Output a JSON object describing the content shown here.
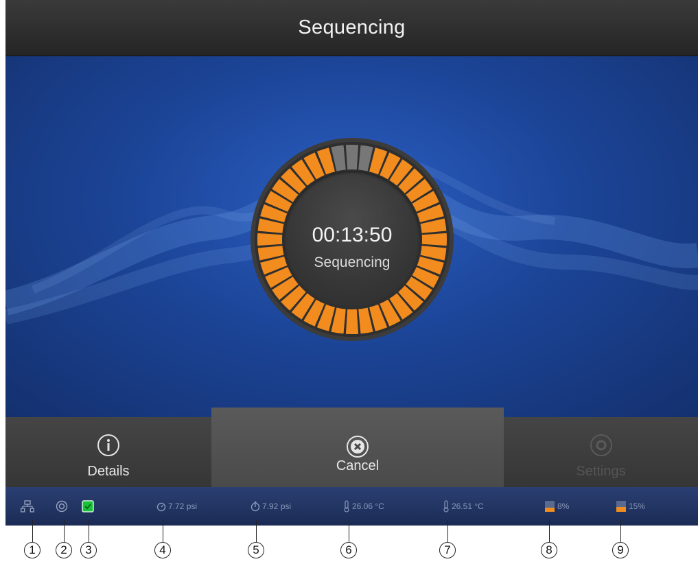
{
  "title": "Sequencing",
  "timer": {
    "time": "00:13:50",
    "status": "Sequencing",
    "segments_total": 40,
    "segments_remaining": 3
  },
  "buttons": {
    "details": "Details",
    "cancel": "Cancel",
    "settings": "Settings"
  },
  "status_bar": {
    "pressure_1": "7.72 psi",
    "pressure_2": "7.92 psi",
    "temperature_1": "26.06 °C",
    "temperature_2": "26.51 °C",
    "level_1": "8%",
    "level_2": "15%"
  },
  "callouts": [
    "1",
    "2",
    "3",
    "4",
    "5",
    "6",
    "7",
    "8",
    "9"
  ],
  "colors": {
    "progress": "#f28c1f",
    "remaining": "#777777",
    "background": "#1c4598",
    "status_ok": "#19c23a"
  }
}
